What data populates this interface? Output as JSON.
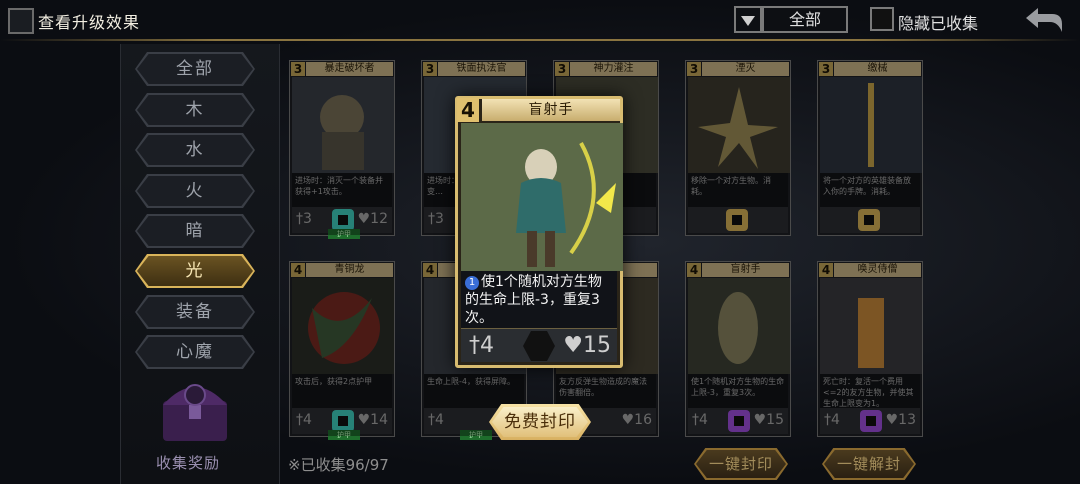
{
  "header": {
    "title": "查看升级效果",
    "filter_value": "全部",
    "hide_collected_label": "隐藏已收集"
  },
  "sidebar": {
    "items": [
      {
        "label": "全部"
      },
      {
        "label": "木"
      },
      {
        "label": "水"
      },
      {
        "label": "火"
      },
      {
        "label": "暗"
      },
      {
        "label": "光",
        "active": true
      },
      {
        "label": "装备"
      },
      {
        "label": "心魔"
      }
    ],
    "reward_label": "收集奖励"
  },
  "cards": [
    {
      "cost": "3",
      "name": "暴走破坏者",
      "desc": "进场时：消灭一个装备并获得+1攻击。",
      "atk": "3",
      "hp": "12",
      "tag": "护甲",
      "race_color": "#3fd0c0"
    },
    {
      "cost": "3",
      "name": "铁面执法官",
      "desc": "进场时：…=5的对…上限变…",
      "atk": "3",
      "hp": "",
      "tag": "",
      "race_color": "#3fd0c0"
    },
    {
      "cost": "3",
      "name": "神力灌注",
      "desc": "…本回合…方生物",
      "atk": "",
      "hp": "",
      "tag": "",
      "race_color": "#d8b458"
    },
    {
      "cost": "3",
      "name": "湮灭",
      "desc": "移除一个对方生物。消耗。",
      "atk": "",
      "hp": "",
      "tag": "",
      "race_color": "#d8b458"
    },
    {
      "cost": "3",
      "name": "缴械",
      "desc": "将一个对方的英雄装备放入你的手牌。消耗。",
      "atk": "",
      "hp": "",
      "tag": "",
      "race_color": "#d8b458"
    },
    {
      "cost": "4",
      "name": "青铜龙",
      "desc": "攻击后，获得2点护甲",
      "atk": "4",
      "hp": "14",
      "tag": "护甲",
      "race_color": "#3fd0c0"
    },
    {
      "cost": "4",
      "name": "七…",
      "desc": "生命上限-4，获得屏障。",
      "atk": "4",
      "hp": "",
      "tag": "护甲",
      "race_color": "#3fd0c0"
    },
    {
      "cost": "4",
      "name": "",
      "desc": "友方反弹生物造成的魔法伤害翻倍。",
      "atk": "",
      "hp": "16",
      "tag": "",
      "race_color": "#a050e0"
    },
    {
      "cost": "4",
      "name": "盲射手",
      "desc": "使1个随机对方生物的生命上限-3，重复3次。",
      "atk": "4",
      "hp": "15",
      "tag": "",
      "race_color": "#a050e0"
    },
    {
      "cost": "4",
      "name": "唤灵侍僧",
      "desc": "死亡时：复活一个费用<=2的友方生物，并使其生命上限变为1。",
      "atk": "4",
      "hp": "13",
      "tag": "",
      "race_color": "#a050e0"
    }
  ],
  "popup": {
    "cost": "4",
    "name": "盲射手",
    "desc_num": "1",
    "desc": "使1个随机对方生物的生命上限-3，重复3次。",
    "atk": "4",
    "hp": "15"
  },
  "actions": {
    "seal_free": "免费封印",
    "seal_all": "一键封印",
    "unseal_all": "一键解封"
  },
  "footer": {
    "collected": "※已收集96/97"
  }
}
